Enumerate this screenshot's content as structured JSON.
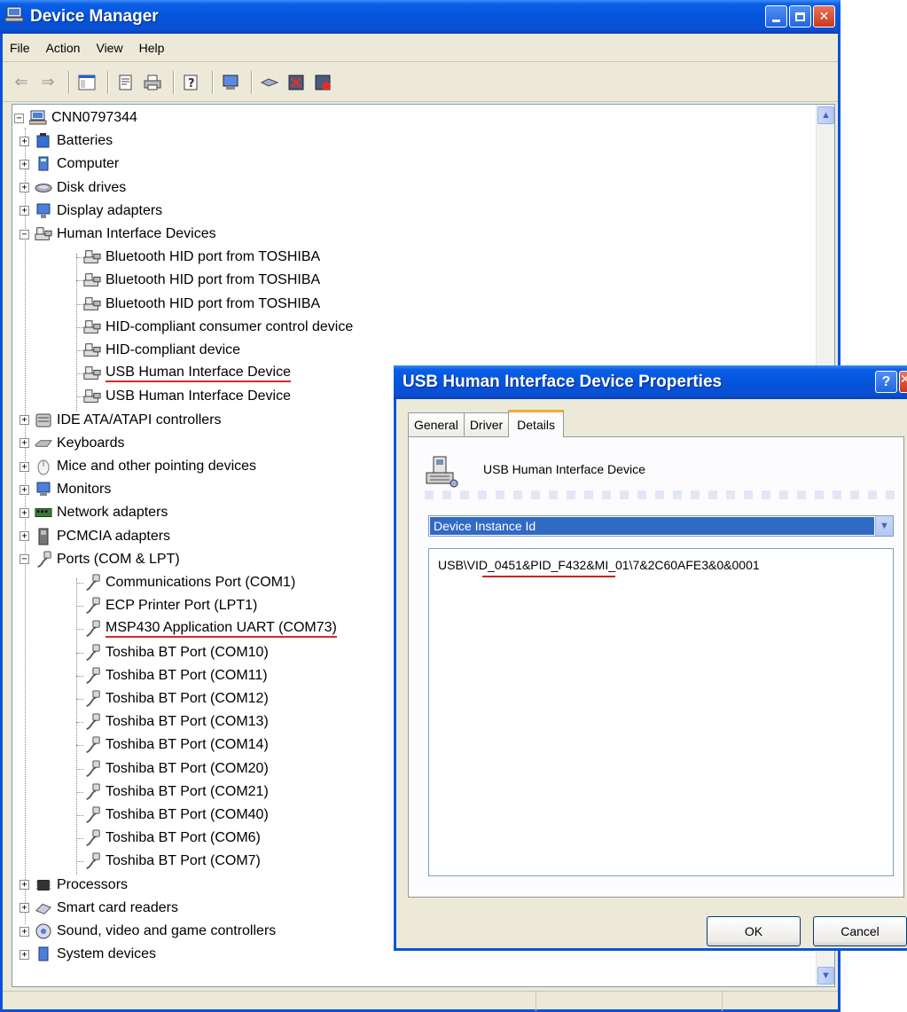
{
  "device_manager": {
    "title": "Device Manager",
    "menu": [
      "File",
      "Action",
      "View",
      "Help"
    ],
    "tree": {
      "root": "CNN0797344",
      "categories_top": [
        "Batteries",
        "Computer",
        "Disk drives",
        "Display adapters"
      ],
      "hid": {
        "label": "Human Interface Devices",
        "children": [
          "Bluetooth HID port from TOSHIBA",
          "Bluetooth HID port from TOSHIBA",
          "Bluetooth HID port from TOSHIBA",
          "HID-compliant consumer control device",
          "HID-compliant device",
          "USB Human Interface Device",
          "USB Human Interface Device"
        ]
      },
      "categories_mid": [
        "IDE ATA/ATAPI controllers",
        "Keyboards",
        "Mice and other pointing devices",
        "Monitors",
        "Network adapters",
        "PCMCIA adapters"
      ],
      "ports": {
        "label": "Ports (COM & LPT)",
        "children": [
          "Communications Port (COM1)",
          "ECP Printer Port (LPT1)",
          "MSP430 Application UART (COM73)",
          "Toshiba BT Port (COM10)",
          "Toshiba BT Port (COM11)",
          "Toshiba BT Port (COM12)",
          "Toshiba BT Port (COM13)",
          "Toshiba BT Port (COM14)",
          "Toshiba BT Port (COM20)",
          "Toshiba BT Port (COM21)",
          "Toshiba BT Port (COM40)",
          "Toshiba BT Port (COM6)",
          "Toshiba BT Port (COM7)"
        ]
      },
      "categories_bottom": [
        "Processors",
        "Smart card readers",
        "Sound, video and game controllers",
        "System devices"
      ]
    }
  },
  "properties_dialog": {
    "title": "USB Human Interface Device Properties",
    "tabs": [
      "General",
      "Driver",
      "Details"
    ],
    "active_tab": "Details",
    "device_name": "USB Human Interface Device",
    "property_select": "Device Instance Id",
    "value": "USB\\VID_0451&PID_F432&MI_01\\7&2C60AFE3&0&0001",
    "ok_label": "OK",
    "cancel_label": "Cancel"
  },
  "colors": {
    "titlebar": "#0454dc",
    "window_face": "#ece9d8",
    "selection": "#316ac5",
    "annotation_underline": "#d21a1a"
  }
}
